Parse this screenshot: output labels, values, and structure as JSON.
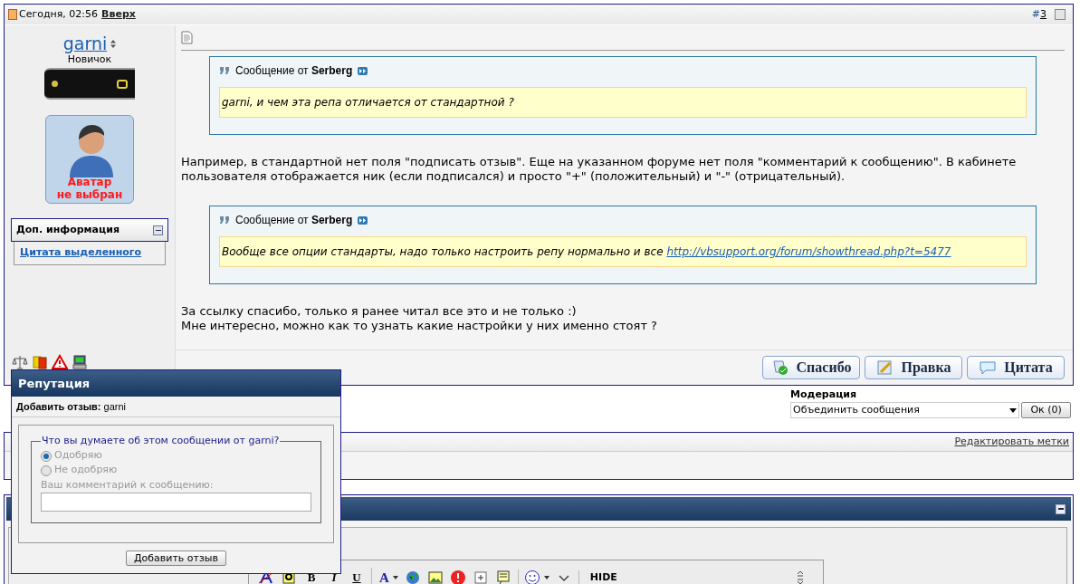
{
  "post": {
    "date": "Сегодня, 02:56",
    "top_link": "Вверх",
    "number_prefix": "#",
    "number": "3",
    "selected": false,
    "author": {
      "name": "garni",
      "rank": "Новичок",
      "avatar_text": [
        "Аватар",
        "не выбран"
      ]
    },
    "extra_info": {
      "title": "Доп. информация",
      "expanded": true,
      "links": [
        "Цитата выделенного"
      ]
    },
    "content": [
      {
        "kind": "quote",
        "header": "Сообщение от **Serberg**",
        "text": "garni, и чем эта репа отличается от стандартной ?"
      },
      {
        "kind": "text",
        "lines": [
          "Например, в стандартной нет поля \"подписать отзыв\". Еще на указанном форуме нет поля \"комментарий к сообщению\". В кабинете пользователя отображается ник (если подписался) и просто \"+\" (положительный) и \"-\" (отрицательный)."
        ]
      },
      {
        "kind": "quote",
        "header": "Сообщение от **Serberg**",
        "text": "Вообще все опции стандарты, надо только настроить репу нормально и все",
        "link": "http://vbsupport.org/forum/showthread.php?t=5477"
      },
      {
        "kind": "text",
        "lines": [
          "За ссылку спасибо, только я ранее читал все это и не только :)",
          "Мне интересно, можно как то узнать какие настройки у них именно стоят ?"
        ]
      }
    ],
    "buttons": [
      "Спасибо",
      "Правка",
      "Цитата"
    ]
  },
  "moderation": {
    "label": "Модерация",
    "select_value": "Объединить сообщения",
    "button": "Ок (0)"
  },
  "tags": {
    "edit_link": "Редактировать метки"
  },
  "editor": {
    "expanded": true,
    "toolbar_letters": [
      "B",
      "I",
      "U",
      "A"
    ],
    "hide_label": "HIDE"
  },
  "reputation_popup": {
    "title": "Репутация",
    "subtitle": "**Добавить отзыв:** garni",
    "legend": "Что вы думаете об этом сообщении от garni?",
    "disabled": true,
    "options": [
      {
        "label": "Одобряю",
        "selected": true
      },
      {
        "label": "Не одобряю",
        "selected": false
      }
    ],
    "comment_label": "Ваш комментарий к сообщению:",
    "submit": "Добавить отзыв"
  }
}
